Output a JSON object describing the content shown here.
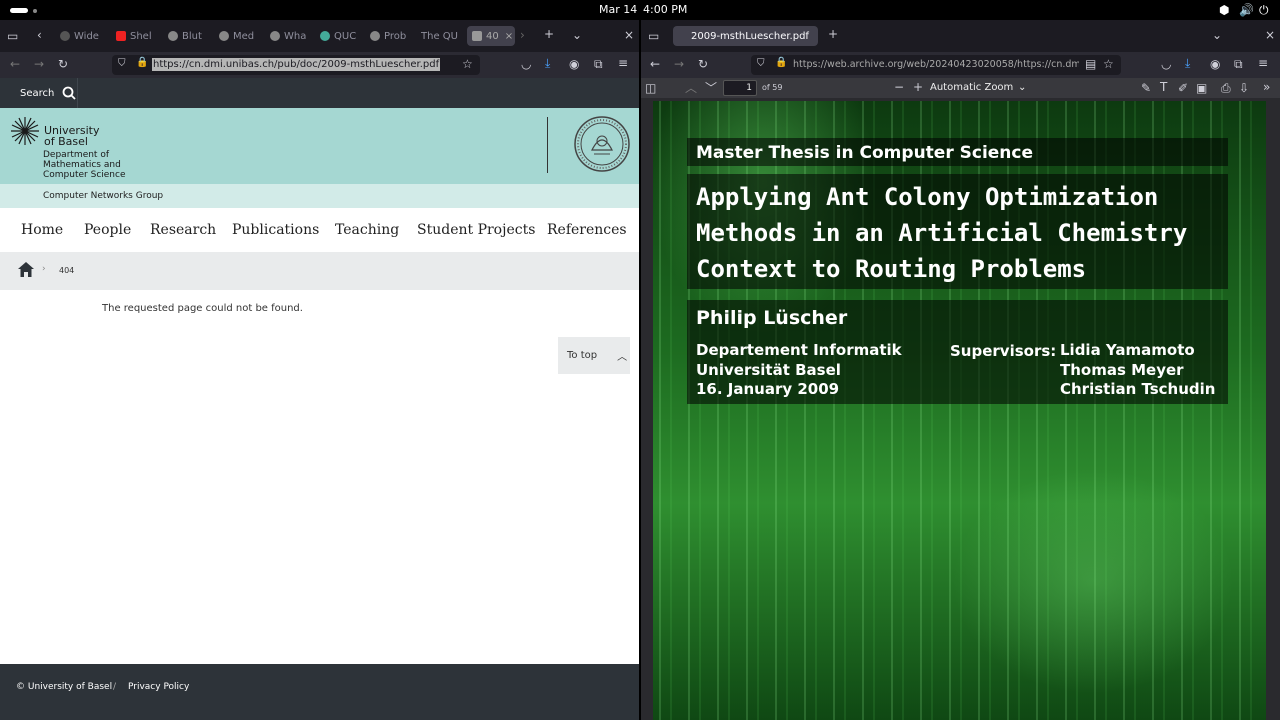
{
  "system": {
    "date": "Mar 14",
    "time": "4:00 PM"
  },
  "left_browser": {
    "tabs": [
      {
        "label": "Wide",
        "color": "#555"
      },
      {
        "label": "Shel",
        "color": "#e22"
      },
      {
        "label": "Blut",
        "color": "#888"
      },
      {
        "label": "Med",
        "color": "#888"
      },
      {
        "label": "Wha",
        "color": "#888"
      },
      {
        "label": "QUC",
        "color": "#4a9"
      },
      {
        "label": "Prob",
        "color": "#888"
      },
      {
        "label": "The QU",
        "color": "#888"
      },
      {
        "label": "40",
        "color": "#888"
      }
    ],
    "url": "https://cn.dmi.unibas.ch/pub/doc/2009-msthLuescher.pdf"
  },
  "site": {
    "search_label": "Search",
    "uni_line1": "University",
    "uni_line2": "of Basel",
    "dept1": "Department of",
    "dept2": "Mathematics and",
    "dept3": "Computer Science",
    "group": "Computer Networks Group",
    "nav": [
      "Home",
      "People",
      "Research",
      "Publications",
      "Teaching",
      "Student Projects",
      "References"
    ],
    "crumb": "404",
    "error_message": "The requested page could not be found.",
    "to_top": "To top",
    "footer_copy": "© University of Basel",
    "footer_sep": "/",
    "footer_privacy": "Privacy Policy"
  },
  "right_browser": {
    "tab_label": "2009-msthLuescher.pdf",
    "url": "https://web.archive.org/web/20240423020058/https://cn.dmi",
    "page_number": "1",
    "page_total": "of 59",
    "zoom": "Automatic Zoom"
  },
  "pdf": {
    "heading": "Master Thesis in Computer Science",
    "title_lines": [
      "Applying Ant Colony Optimization",
      "Methods in an Artificial Chemistry",
      "Context to Routing Problems"
    ],
    "author": "Philip Lüscher",
    "affil1": "Departement Informatik",
    "affil2": "Universität Basel",
    "affil3": "16. January 2009",
    "supervisors_label": "Supervisors:",
    "supervisors": [
      "Lidia Yamamoto",
      "Thomas Meyer",
      "Christian Tschudin"
    ]
  }
}
